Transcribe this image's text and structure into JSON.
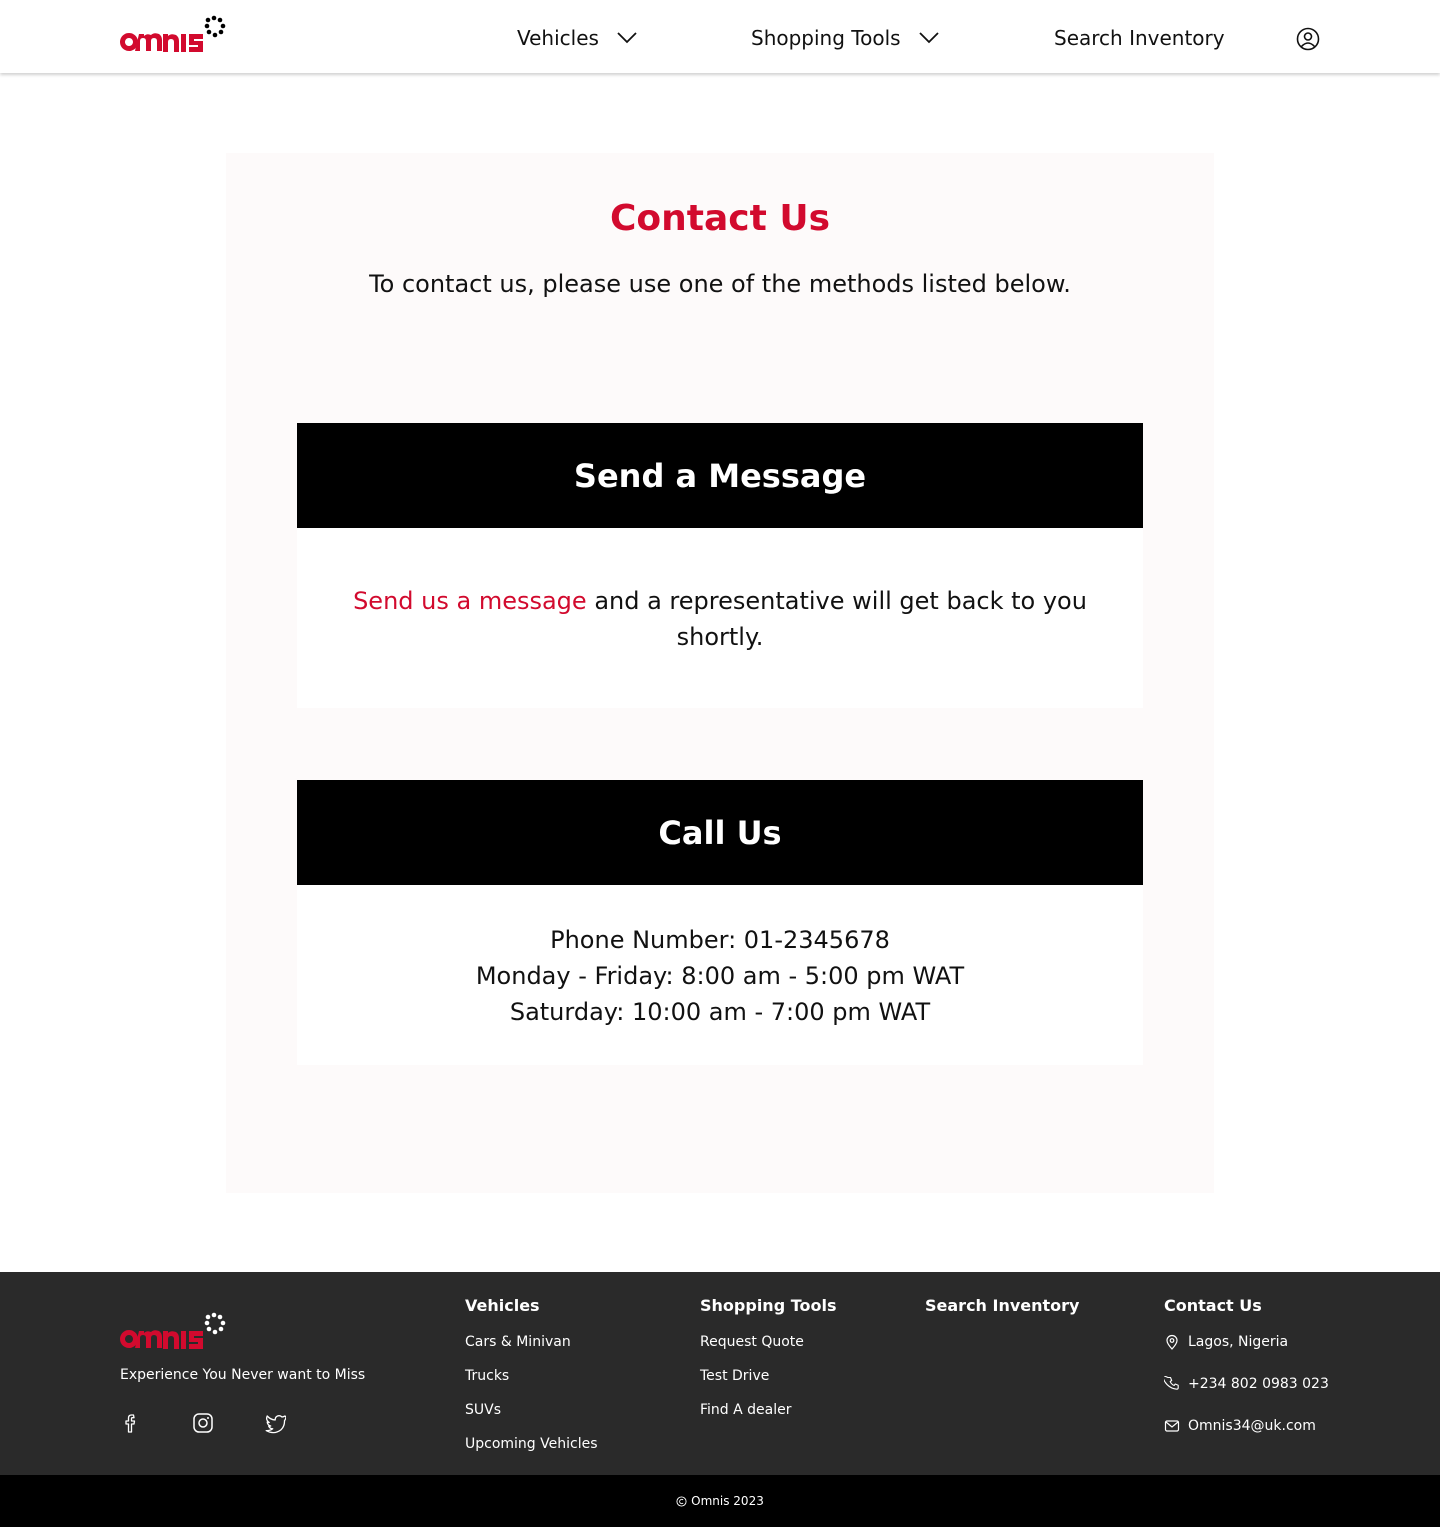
{
  "brand": {
    "name": "omnis",
    "accent_color": "#d20a2e"
  },
  "header": {
    "nav": [
      {
        "label": "Vehicles",
        "icon": "chevron-down-icon"
      },
      {
        "label": "Shopping Tools",
        "icon": "chevron-down-icon"
      },
      {
        "label": "Search Inventory"
      }
    ],
    "user_icon": "user-circle-icon"
  },
  "main": {
    "title": "Contact Us",
    "subtitle": "To contact us, please use one of the methods listed below.",
    "message_section": {
      "heading": "Send a Message",
      "link_text": "Send us a message",
      "body_text": " and a representative will get back to you shortly."
    },
    "call_section": {
      "heading": "Call Us",
      "lines": [
        "Phone Number: 01-2345678",
        "Monday - Friday: 8:00 am - 5:00 pm WAT",
        "Saturday: 10:00 am - 7:00 pm WAT"
      ]
    }
  },
  "footer": {
    "tagline": "Experience You Never want to Miss",
    "social_icons": [
      "facebook-icon",
      "instagram-icon",
      "twitter-icon"
    ],
    "columns": [
      {
        "heading": "Vehicles",
        "links": [
          "Cars & Minivan",
          "Trucks",
          "SUVs",
          "Upcoming Vehicles"
        ]
      },
      {
        "heading": "Shopping Tools",
        "links": [
          "Request Quote",
          "Test Drive",
          "Find A dealer"
        ]
      },
      {
        "heading": "Search Inventory",
        "links": []
      },
      {
        "heading": "Contact Us"
      }
    ],
    "contact": [
      {
        "icon": "location-pin-icon",
        "text": "Lagos, Nigeria"
      },
      {
        "icon": "phone-icon",
        "text": "+234 802 0983 023"
      },
      {
        "icon": "mail-icon",
        "text": "Omnis34@uk.com"
      }
    ],
    "copyright": "Omnis 2023"
  }
}
